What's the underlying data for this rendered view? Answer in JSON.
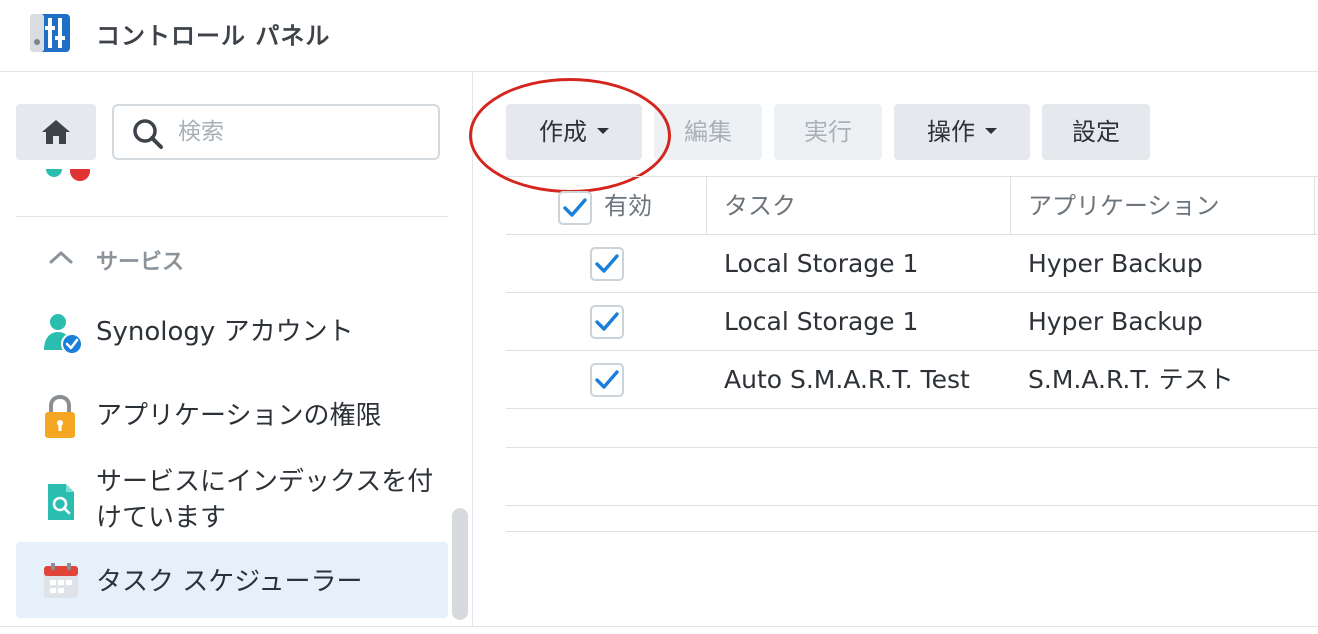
{
  "window": {
    "title": "コントロール パネル",
    "icon": "control-panel-icon"
  },
  "sidebar": {
    "search": {
      "placeholder": "検索",
      "value": ""
    },
    "section_header": "サービス",
    "items": [
      {
        "label": "Synology アカウント",
        "icon": "synology-account-icon"
      },
      {
        "label": "アプリケーションの権限",
        "icon": "lock-icon"
      },
      {
        "label": "サービスにインデックスを付けています",
        "icon": "index-search-icon"
      },
      {
        "label": "タスク スケジューラー",
        "icon": "calendar-icon",
        "active": true
      }
    ]
  },
  "toolbar": {
    "create": "作成",
    "edit": "編集",
    "run": "実行",
    "action": "操作",
    "settings": "設定"
  },
  "table": {
    "columns": [
      "有効",
      "タスク",
      "アプリケーション"
    ],
    "rows": [
      {
        "enabled": true,
        "task": "Local Storage 1",
        "application": "Hyper Backup"
      },
      {
        "enabled": true,
        "task": "Local Storage 1",
        "application": "Hyper Backup"
      },
      {
        "enabled": true,
        "task": "Auto S.M.A.R.T. Test",
        "application": "S.M.A.R.T. テスト"
      }
    ]
  },
  "colors": {
    "accent": "#1a7fd9",
    "highlight_ellipse": "#d4261f",
    "active_item_bg": "#e6f0fb"
  }
}
